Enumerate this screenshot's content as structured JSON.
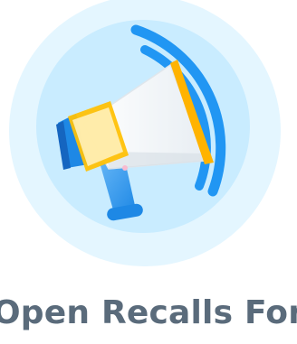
{
  "card": {
    "icon": "megaphone-icon",
    "title": "Open Recalls For"
  },
  "colors": {
    "circle_outer": "#e4f6ff",
    "circle_inner": "#c9ecff",
    "wave_blue": "#2196f3",
    "bell_yellow": "#ffc107",
    "handle_blue": "#42a5f5",
    "title_text": "#5a6b7b"
  }
}
